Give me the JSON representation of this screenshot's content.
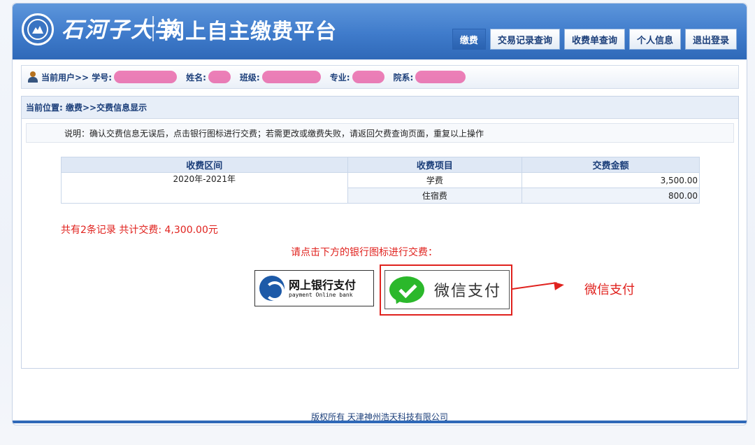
{
  "header": {
    "university_name": "石河子大学",
    "platform_title": "网上自主缴费平台",
    "nav": [
      "缴费",
      "交易记录查询",
      "收费单查询",
      "个人信息",
      "退出登录"
    ]
  },
  "user_bar": {
    "current_user": "当前用户>> 学号:",
    "name_label": "姓名:",
    "class_label": "班级:",
    "major_label": "专业:",
    "dept_label": "院系:"
  },
  "breadcrumb": "当前位置: 缴费>>交费信息显示",
  "note": "说明：确认交费信息无误后，点击银行图标进行交费；若需更改或缴费失败，请返回欠费查询页面，重复以上操作",
  "table": {
    "headers": [
      "收费区间",
      "收费项目",
      "交费金额"
    ],
    "period": "2020年-2021年",
    "rows": [
      {
        "item": "学费",
        "amount": "3,500.00"
      },
      {
        "item": "住宿费",
        "amount": "800.00"
      }
    ]
  },
  "summary": "共有2条记录 共计交费: 4,300.00元",
  "prompt": "请点击下方的银行图标进行交费：",
  "bank_button": {
    "main": "网上银行支付",
    "sub": "payment Online bank"
  },
  "wechat_button": {
    "label": "微信支付"
  },
  "annotation": "微信支付",
  "footer": "版权所有 天津神州浩天科技有限公司",
  "colors": {
    "primary_blue": "#3f7bcb",
    "alert_red": "#e0221e",
    "wechat_green": "#2bb82b"
  }
}
